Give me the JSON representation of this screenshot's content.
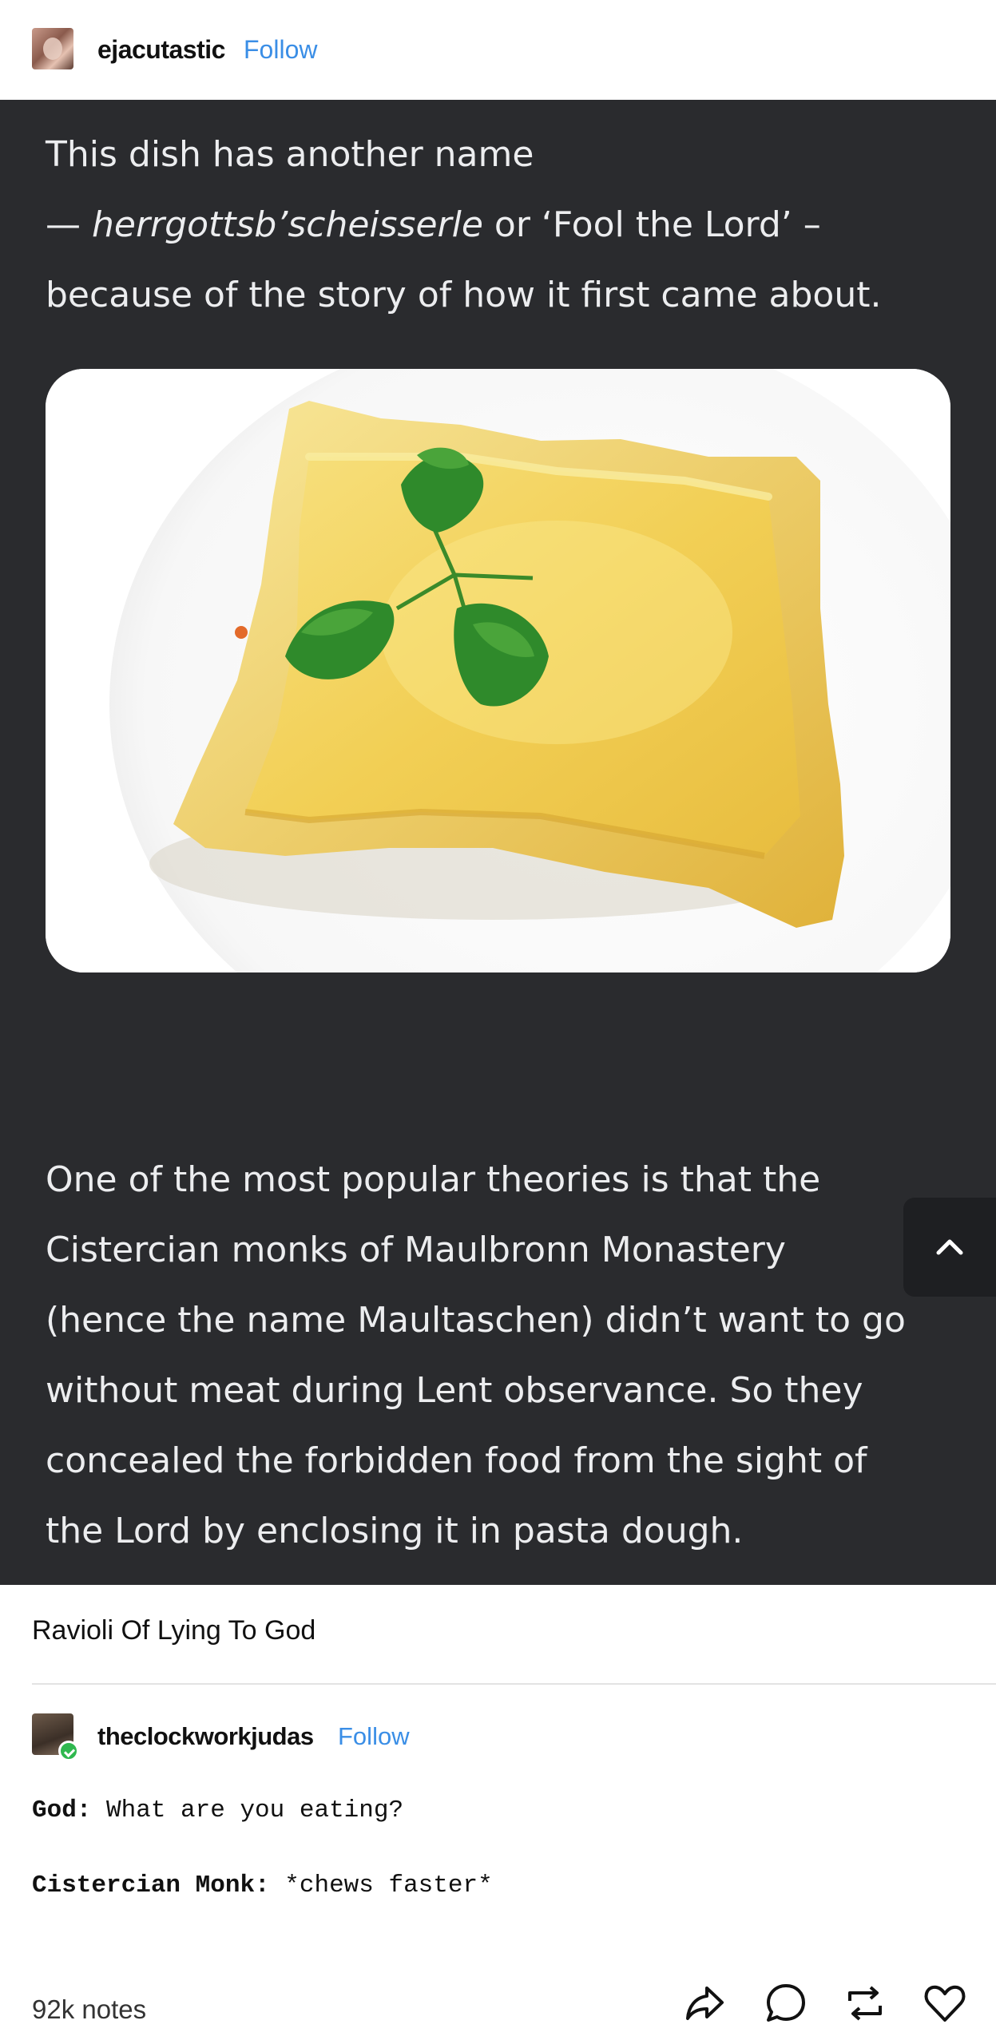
{
  "post": {
    "author": "ejacutastic",
    "follow_label": "Follow",
    "body_lines": [
      "This dish has another name",
      "herrgottsb’scheisserle",
      " or ‘Fool the Lord’ –",
      "because of the story of how it first came about."
    ],
    "dash_prefix": "— ",
    "body_lines_2": [
      "One of the most popular theories is that the",
      "Cistercian monks of Maulbronn Monastery",
      "(hence the name Maultaschen) didn’t want to go",
      "without meat during Lent observance. So they",
      "concealed the forbidden food from the sight of",
      "the Lord by enclosing it in pasta dough."
    ],
    "image_alt": "ravioli-with-parsley-photo",
    "caption": "Ravioli Of Lying To God"
  },
  "reply": {
    "author": "theclockworkjudas",
    "follow_label": "Follow",
    "lines": [
      {
        "speaker": "God:",
        "text": " What are you eating?"
      },
      {
        "speaker": "Cistercian Monk:",
        "text": " *chews faster*"
      }
    ]
  },
  "footer": {
    "notes": "92k notes",
    "actions": [
      "share-icon",
      "comment-icon",
      "reblog-icon",
      "like-icon"
    ]
  },
  "colors": {
    "dark_bg": "#2a2b2e",
    "follow_blue": "#3a8ee6",
    "badge_green": "#2fb84f"
  }
}
